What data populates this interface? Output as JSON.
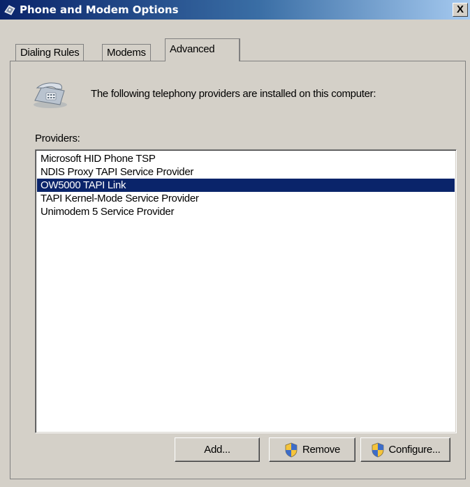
{
  "window": {
    "title": "Phone and Modem Options",
    "close_label": "X",
    "icon": "phone-modem-icon"
  },
  "tabs": [
    {
      "label": "Dialing Rules",
      "active": false
    },
    {
      "label": "Modems",
      "active": false
    },
    {
      "label": "Advanced",
      "active": true
    }
  ],
  "advanced": {
    "description": "The following telephony providers are installed on this computer:",
    "providers_label": "Providers:",
    "providers": [
      "Microsoft HID Phone TSP",
      "NDIS Proxy TAPI Service Provider",
      "OW5000 TAPI Link",
      "TAPI Kernel-Mode Service Provider",
      "Unimodem 5 Service Provider"
    ],
    "selected_provider": "OW5000 TAPI Link",
    "buttons": {
      "add": "Add...",
      "remove": "Remove",
      "configure": "Configure..."
    }
  },
  "colors": {
    "selection": "#0a246a",
    "face": "#d4d0c8"
  }
}
